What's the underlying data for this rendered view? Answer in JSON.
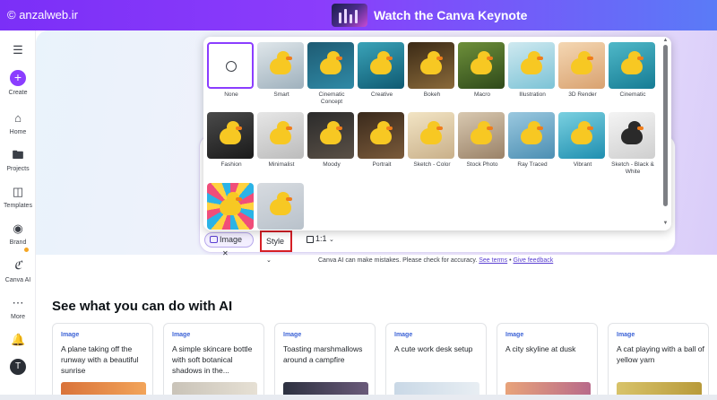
{
  "banner": {
    "watermark": "© anzalweb.ir",
    "title": "Watch the Canva Keynote"
  },
  "sidebar": {
    "items": [
      {
        "label": "",
        "icon": "menu-icon"
      },
      {
        "label": "Create",
        "icon": "plus-icon"
      },
      {
        "label": "Home",
        "icon": "home-icon"
      },
      {
        "label": "Projects",
        "icon": "folder-icon"
      },
      {
        "label": "Templates",
        "icon": "templates-icon"
      },
      {
        "label": "Brand",
        "icon": "brand-icon"
      },
      {
        "label": "Canva AI",
        "icon": "canva-ai-icon"
      },
      {
        "label": "More",
        "icon": "more-icon"
      }
    ],
    "avatar": "T"
  },
  "styles": [
    {
      "label": "None"
    },
    {
      "label": "Smart"
    },
    {
      "label": "Cinematic Concept"
    },
    {
      "label": "Creative"
    },
    {
      "label": "Bokeh"
    },
    {
      "label": "Macro"
    },
    {
      "label": "Illustration"
    },
    {
      "label": "3D Render"
    },
    {
      "label": "Cinematic"
    },
    {
      "label": "Fashion"
    },
    {
      "label": "Minimalist"
    },
    {
      "label": "Moody"
    },
    {
      "label": "Portrait"
    },
    {
      "label": "Sketch - Color"
    },
    {
      "label": "Stock Photo"
    },
    {
      "label": "Ray Traced"
    },
    {
      "label": "Vibrant"
    },
    {
      "label": "Sketch - Black & White"
    },
    {
      "label": ""
    },
    {
      "label": ""
    }
  ],
  "toolbar": {
    "image_chip": "Image",
    "style_chip": "Style",
    "ratio_chip": "1:1"
  },
  "disclaimer": {
    "text": "Canva AI can make mistakes. Please check for accuracy.",
    "terms": "See terms",
    "sep": "•",
    "feedback": "Give feedback"
  },
  "section": {
    "title": "See what you can do with AI",
    "cards": [
      {
        "tag": "Image",
        "text": "A plane taking off the runway with a beautiful sunrise"
      },
      {
        "tag": "Image",
        "text": "A simple skincare bottle with soft botanical shadows in the..."
      },
      {
        "tag": "Image",
        "text": "Toasting marshmallows around a campfire"
      },
      {
        "tag": "Image",
        "text": "A cute work desk setup"
      },
      {
        "tag": "Image",
        "text": "A city skyline at dusk"
      },
      {
        "tag": "Image",
        "text": "A cat playing with a ball of yellow yarn"
      }
    ]
  }
}
